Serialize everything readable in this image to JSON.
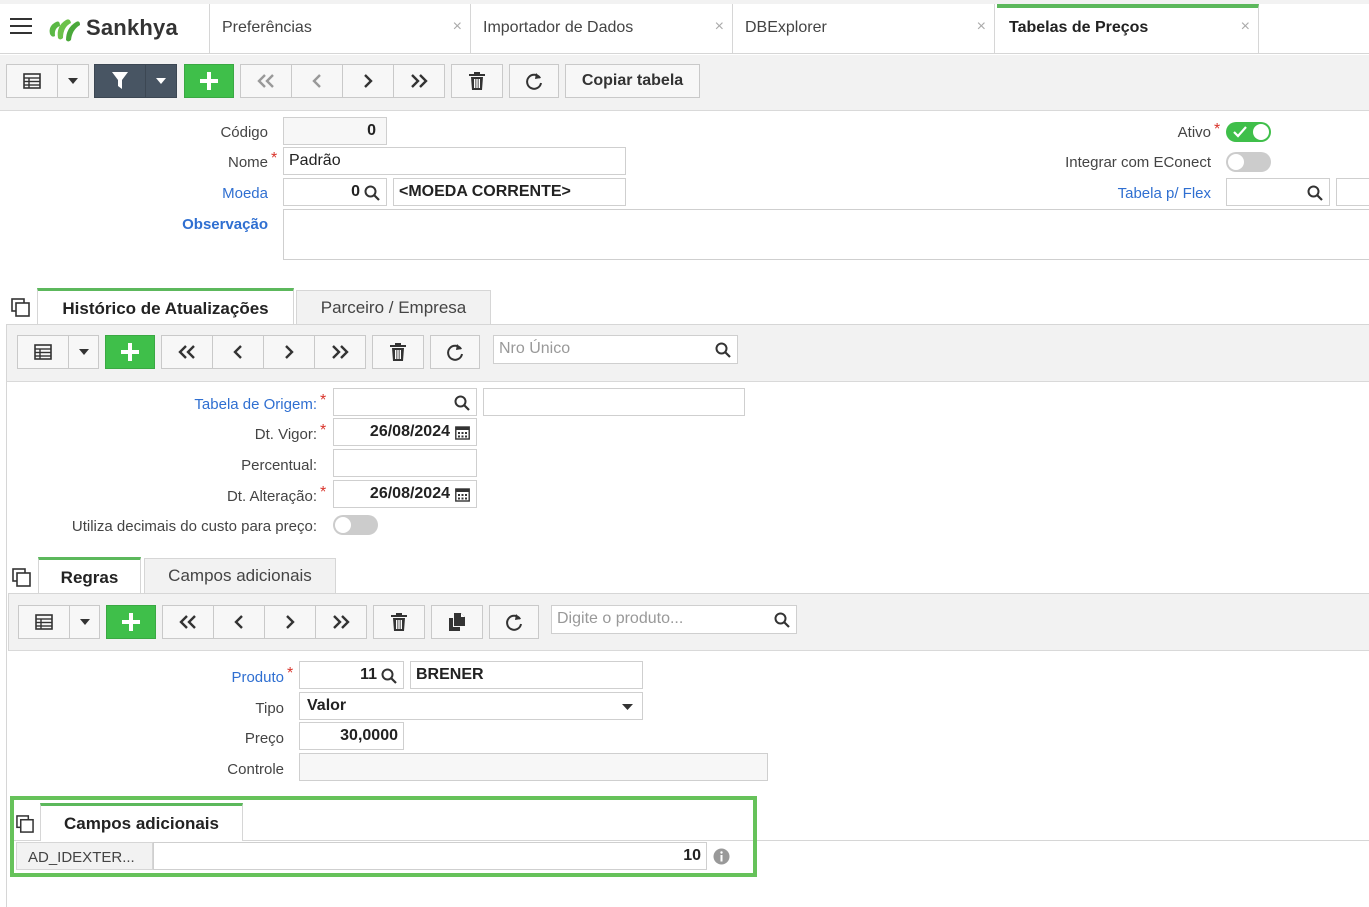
{
  "app": {
    "logo_text": "Sankhya",
    "tabs": [
      {
        "label": "Preferências"
      },
      {
        "label": "Importador de Dados"
      },
      {
        "label": "DBExplorer"
      },
      {
        "label": "Tabelas de Preços"
      }
    ],
    "close_glyph": "×",
    "accent_color": "#5cb85c"
  },
  "main_toolbar": {
    "copy_label": "Copiar tabela"
  },
  "header_form": {
    "codigo_label": "Código",
    "codigo_value": "0",
    "nome_label": "Nome",
    "nome_value": "Padrão",
    "moeda_label": "Moeda",
    "moeda_code": "0",
    "moeda_desc": "<MOEDA CORRENTE>",
    "observacao_label": "Observação",
    "ativo_label": "Ativo",
    "ativo_on": true,
    "econect_label": "Integrar com EConect",
    "econect_on": false,
    "flex_label": "Tabela p/ Flex"
  },
  "historico": {
    "tabs": [
      {
        "label": "Histórico de Atualizações"
      },
      {
        "label": "Parceiro / Empresa"
      }
    ],
    "search_placeholder": "Nro Único",
    "tabela_origem_label": "Tabela de Origem:",
    "dt_vigor_label": "Dt. Vigor:",
    "dt_vigor_value": "26/08/2024",
    "percentual_label": "Percentual:",
    "dt_alteracao_label": "Dt. Alteração:",
    "dt_alteracao_value": "26/08/2024",
    "decimais_label": "Utiliza decimais do custo para preço:",
    "decimais_on": false
  },
  "regras": {
    "tabs": [
      {
        "label": "Regras"
      },
      {
        "label": "Campos adicionais"
      }
    ],
    "search_placeholder": "Digite o produto...",
    "produto_label": "Produto",
    "produto_code": "11",
    "produto_desc": "BRENER",
    "tipo_label": "Tipo",
    "tipo_value": "Valor",
    "preco_label": "Preço",
    "preco_value": "30,0000",
    "controle_label": "Controle"
  },
  "campos_adicionais": {
    "tab_label": "Campos adicionais",
    "field_label": "AD_IDEXTER...",
    "field_value": "10"
  }
}
